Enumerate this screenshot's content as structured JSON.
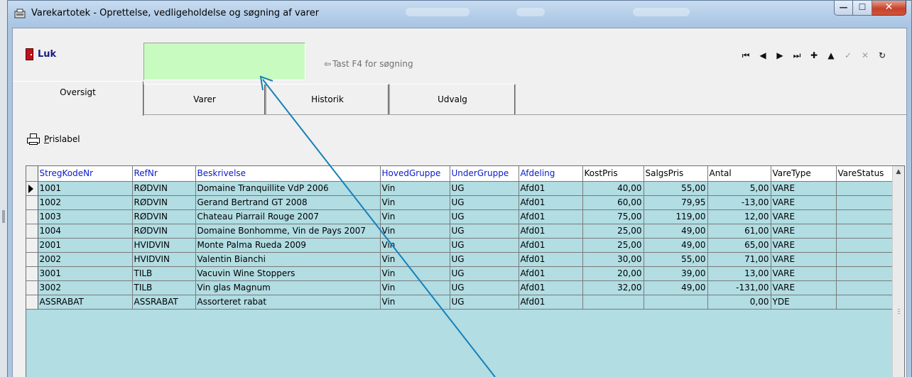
{
  "window": {
    "title": "Varekartotek - Oprettelse, vedligeholdelse og søgning af varer",
    "minimize_glyph": "—",
    "maximize_glyph": "☐",
    "close_glyph": "✕"
  },
  "toolbar": {
    "close_label": "Luk",
    "search_value": "",
    "search_hint": "Tast F4 for søgning",
    "hint_arrow": "⇦",
    "nav": [
      {
        "name": "first-record-icon",
        "glyph": "⏮",
        "enabled": true
      },
      {
        "name": "prev-record-icon",
        "glyph": "◀",
        "enabled": true
      },
      {
        "name": "next-record-icon",
        "glyph": "▶",
        "enabled": true
      },
      {
        "name": "last-record-icon",
        "glyph": "⏭",
        "enabled": true
      },
      {
        "name": "insert-record-icon",
        "glyph": "✚",
        "enabled": true
      },
      {
        "name": "delete-record-icon",
        "glyph": "▲",
        "enabled": true
      },
      {
        "name": "post-record-icon",
        "glyph": "✓",
        "enabled": false
      },
      {
        "name": "cancel-record-icon",
        "glyph": "✕",
        "enabled": false
      },
      {
        "name": "refresh-icon",
        "glyph": "↻",
        "enabled": true
      }
    ]
  },
  "tabs": [
    "Oversigt",
    "Varer",
    "Historik",
    "Udvalg"
  ],
  "actions": {
    "prislabel_first": "P",
    "prislabel_rest": "rislabel"
  },
  "grid": {
    "columns": [
      "StregKodeNr",
      "RefNr",
      "Beskrivelse",
      "HovedGruppe",
      "UnderGruppe",
      "Afdeling",
      "KostPris",
      "SalgsPris",
      "Antal",
      "VareType",
      "VareStatus"
    ],
    "rows": [
      [
        "1001",
        "RØDVIN",
        "Domaine Tranquillite VdP 2006",
        "Vin",
        "UG",
        "Afd01",
        "40,00",
        "55,00",
        "5,00",
        "VARE",
        ""
      ],
      [
        "1002",
        "RØDVIN",
        "Gerand Bertrand GT 2008",
        "Vin",
        "UG",
        "Afd01",
        "60,00",
        "79,95",
        "-13,00",
        "VARE",
        ""
      ],
      [
        "1003",
        "RØDVIN",
        "Chateau Piarrail Rouge 2007",
        "Vin",
        "UG",
        "Afd01",
        "75,00",
        "119,00",
        "12,00",
        "VARE",
        ""
      ],
      [
        "1004",
        "RØDVIN",
        "Domaine Bonhomme, Vin de Pays 2007",
        "Vin",
        "UG",
        "Afd01",
        "25,00",
        "49,00",
        "61,00",
        "VARE",
        ""
      ],
      [
        "2001",
        "HVIDVIN",
        "Monte Palma Rueda 2009",
        "Vin",
        "UG",
        "Afd01",
        "25,00",
        "49,00",
        "65,00",
        "VARE",
        ""
      ],
      [
        "2002",
        "HVIDVIN",
        "Valentin Bianchi",
        "Vin",
        "UG",
        "Afd01",
        "30,00",
        "55,00",
        "71,00",
        "VARE",
        ""
      ],
      [
        "3001",
        "TILB",
        "Vacuvin Wine Stoppers",
        "Vin",
        "UG",
        "Afd01",
        "20,00",
        "39,00",
        "13,00",
        "VARE",
        ""
      ],
      [
        "3002",
        "TILB",
        "Vin glas Magnum",
        "Vin",
        "UG",
        "Afd01",
        "32,00",
        "49,00",
        "-131,00",
        "VARE",
        ""
      ],
      [
        "ASSRABAT",
        "ASSRABAT",
        "Assorteret rabat",
        "Vin",
        "UG",
        "Afd01",
        "",
        "",
        "0,00",
        "YDE",
        ""
      ]
    ],
    "current_row_index": 0
  },
  "colors": {
    "search_bg": "#c8fbc0",
    "grid_bg": "#b1dde3",
    "header_text": "#0a1acb",
    "annotation_arrow": "#1780b8"
  }
}
